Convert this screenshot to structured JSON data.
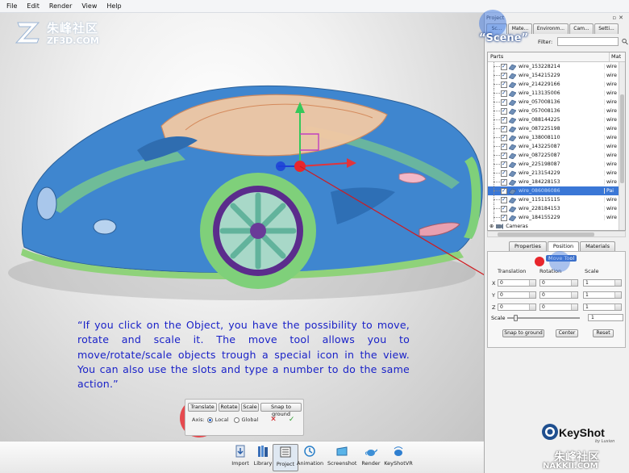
{
  "menu": [
    "File",
    "Edit",
    "Render",
    "View",
    "Help"
  ],
  "watermark": {
    "cn": "朱峰社区",
    "en": "ZF3D.COM",
    "cn2": "朱峰社区",
    "en2": "NAKKII.COM"
  },
  "annotation": {
    "caption": "“If you click on the Object, you have the possibility to move, rotate and scale it. The move tool allows you to move/rotate/scale objects trough a special icon in the view. You can also use the slots and type a number to do the same action.”",
    "scene_label": "“Scene”",
    "highlight_color": "#e8262c",
    "highlight_blue": "#4a7fe0"
  },
  "transform_bar": {
    "buttons": [
      "Translate",
      "Rotate",
      "Scale",
      "Snap to ground"
    ],
    "axis_label": "Axis:",
    "local": "Local",
    "global": "Global"
  },
  "dock": [
    "Import",
    "Library",
    "Project",
    "Animation",
    "Screenshot",
    "Render",
    "KeyShotVR"
  ],
  "panel": {
    "title": "Project",
    "tabs": [
      "Sc...",
      "Mate...",
      "Environm...",
      "Cam...",
      "Setti..."
    ],
    "filter_label": "Filter:",
    "col_parts": "Parts",
    "col_mat": "Mat",
    "rows": [
      {
        "name": "wire_153228214",
        "mat": "wire"
      },
      {
        "name": "wire_154215229",
        "mat": "wire"
      },
      {
        "name": "wire_214229166",
        "mat": "wire"
      },
      {
        "name": "wire_113135006",
        "mat": "wire"
      },
      {
        "name": "wire_057008136",
        "mat": "wire"
      },
      {
        "name": "wire_057008136",
        "mat": "wire"
      },
      {
        "name": "wire_088144225",
        "mat": "wire"
      },
      {
        "name": "wire_087225198",
        "mat": "wire"
      },
      {
        "name": "wire_138008110",
        "mat": "wire"
      },
      {
        "name": "wire_143225087",
        "mat": "wire"
      },
      {
        "name": "wire_087225087",
        "mat": "wire"
      },
      {
        "name": "wire_225198087",
        "mat": "wire"
      },
      {
        "name": "wire_213154229",
        "mat": "wire"
      },
      {
        "name": "wire_184228153",
        "mat": "wire"
      },
      {
        "name": "wire_086086086",
        "mat": "Pai",
        "selected": true
      },
      {
        "name": "wire_115115115",
        "mat": "wire"
      },
      {
        "name": "wire_228184153",
        "mat": "wire"
      },
      {
        "name": "wire_184155229",
        "mat": "wire"
      }
    ],
    "cameras": "Cameras",
    "sub_tabs": [
      "Properties",
      "Position",
      "Materials"
    ],
    "move_tool": "Move Tool",
    "col_translation": "Translation",
    "col_rotation": "Rotation",
    "col_scale": "Scale",
    "axes": [
      "X",
      "Y",
      "Z"
    ],
    "translation": [
      "0",
      "0",
      "0"
    ],
    "rotation": [
      "0",
      "0",
      "0"
    ],
    "scale": [
      "1",
      "1",
      "1"
    ],
    "scale_label": "Scale",
    "scale_value": "1",
    "snap_button": "Snap to ground",
    "center_button": "Center",
    "reset_button": "Reset"
  },
  "brand": {
    "name": "KeyShot",
    "by": "by Luxion"
  }
}
